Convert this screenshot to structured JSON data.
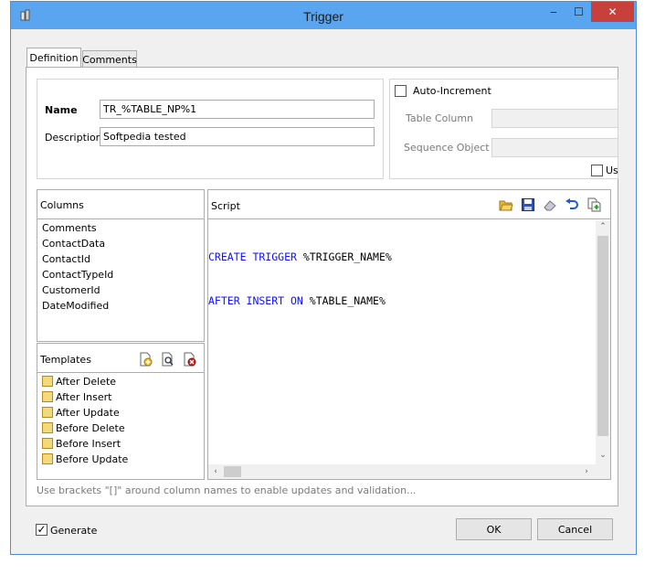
{
  "window": {
    "title": "Trigger",
    "minimize_glyph": "‒",
    "maximize_glyph": "☐",
    "close_glyph": "✕"
  },
  "tabs": [
    {
      "label": "Definition",
      "active": true
    },
    {
      "label": "Comments",
      "active": false
    }
  ],
  "definition": {
    "name_label": "Name",
    "name_value": "TR_%TABLE_NP%1",
    "description_label": "Description",
    "description_value": "Softpedia tested"
  },
  "auto_increment": {
    "label": "Auto-Increment",
    "checked": false,
    "table_column_label": "Table Column",
    "sequence_object_label": "Sequence Object",
    "use_label": "Us"
  },
  "columns": {
    "header": "Columns",
    "items": [
      "Comments",
      "ContactData",
      "ContactId",
      "ContactTypeId",
      "CustomerId",
      "DateModified"
    ]
  },
  "templates": {
    "header": "Templates",
    "items": [
      "After Delete",
      "After Insert",
      "After Update",
      "Before Delete",
      "Before Insert",
      "Before Update"
    ]
  },
  "script": {
    "header": "Script",
    "line1": {
      "kw1": "CREATE TRIGGER",
      "rest": " %TRIGGER_NAME%"
    },
    "line2": {
      "kw1": "AFTER INSERT ON",
      "rest": " %TABLE_NAME%"
    },
    "toolbar_icons": [
      "open-folder-icon",
      "save-icon",
      "eraser-icon",
      "undo-icon",
      "copy-icon"
    ]
  },
  "hint": "Use brackets \"[]\" around column names to enable updates and validation...",
  "footer": {
    "generate_label": "Generate",
    "generate_checked": true,
    "ok_label": "OK",
    "cancel_label": "Cancel"
  },
  "colors": {
    "titlebar": "#5aa5f0",
    "close_button": "#c7403b",
    "sql_keyword": "#1010ff"
  }
}
